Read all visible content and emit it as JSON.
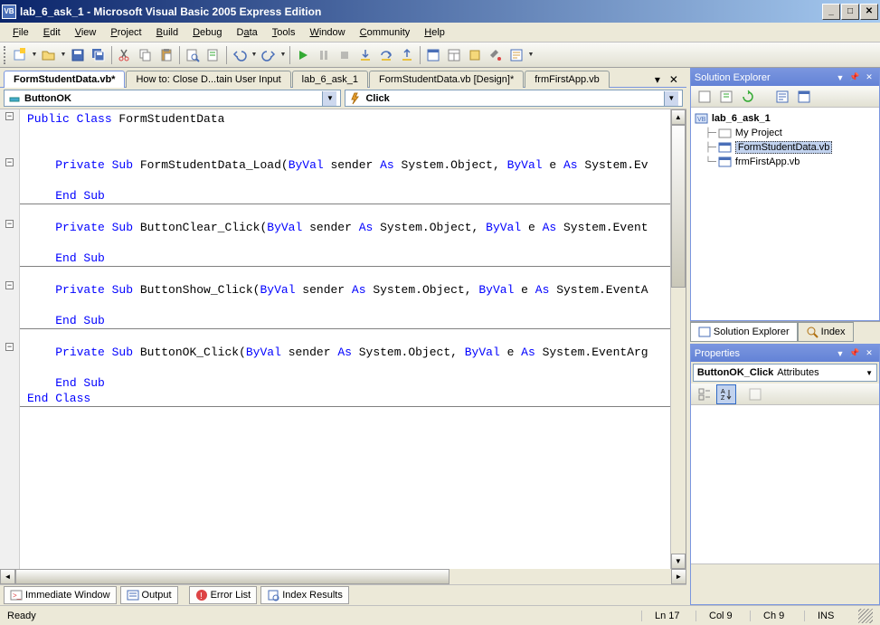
{
  "title": "lab_6_ask_1 - Microsoft Visual Basic 2005 Express Edition",
  "menu": [
    "File",
    "Edit",
    "View",
    "Project",
    "Build",
    "Debug",
    "Data",
    "Tools",
    "Window",
    "Community",
    "Help"
  ],
  "doctabs": [
    {
      "label": "FormStudentData.vb*",
      "active": true
    },
    {
      "label": "How to: Close D...tain User Input",
      "active": false
    },
    {
      "label": "lab_6_ask_1",
      "active": false
    },
    {
      "label": "FormStudentData.vb [Design]*",
      "active": false
    },
    {
      "label": "frmFirstApp.vb",
      "active": false
    }
  ],
  "codeDropdown": {
    "left": "ButtonOK",
    "right": "Click"
  },
  "code": {
    "l1": "Public Class FormStudentData",
    "l2": "",
    "l3": "    Private Sub FormStudentData_Load(ByVal sender As System.Object, ByVal e As System.Ev",
    "l4": "",
    "l5": "    End Sub",
    "l6": "",
    "l7": "    Private Sub ButtonClear_Click(ByVal sender As System.Object, ByVal e As System.Event",
    "l8": "",
    "l9": "    End Sub",
    "l10": "",
    "l11": "    Private Sub ButtonShow_Click(ByVal sender As System.Object, ByVal e As System.EventA",
    "l12": "",
    "l13": "    End Sub",
    "l14": "",
    "l15": "    Private Sub ButtonOK_Click(ByVal sender As System.Object, ByVal e As System.EventArg",
    "l16": "",
    "l17": "    End Sub",
    "l18": "End Class"
  },
  "solutionExplorer": {
    "title": "Solution Explorer",
    "project": "lab_6_ask_1",
    "items": [
      "My Project",
      "FormStudentData.vb",
      "frmFirstApp.vb"
    ],
    "selected": "FormStudentData.vb"
  },
  "rightTabs": [
    "Solution Explorer",
    "Index"
  ],
  "properties": {
    "title": "Properties",
    "combo": "ButtonOK_Click Attributes"
  },
  "bottomTabs": [
    "Immediate Window",
    "Output",
    "Error List",
    "Index Results"
  ],
  "status": {
    "ready": "Ready",
    "ln": "Ln 17",
    "col": "Col 9",
    "ch": "Ch 9",
    "ins": "INS"
  }
}
